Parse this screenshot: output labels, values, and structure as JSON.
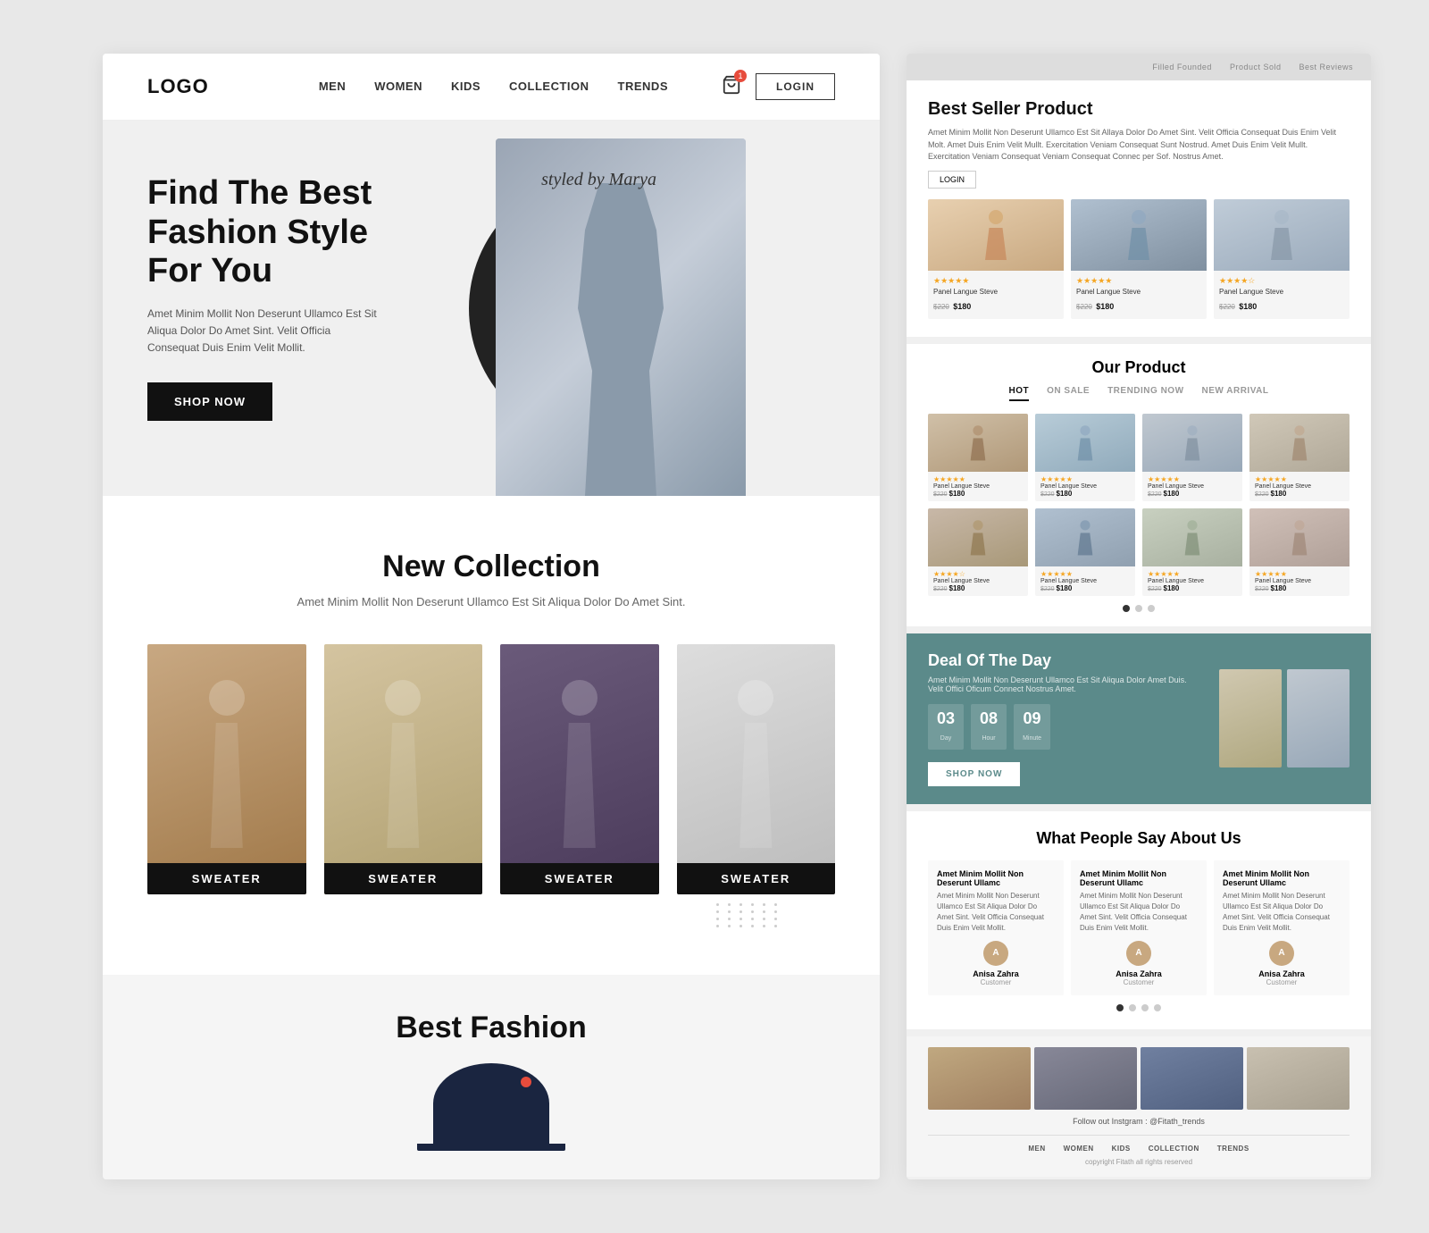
{
  "nav": {
    "logo": "LOGO",
    "links": [
      "MEN",
      "WOMEN",
      "KIDS",
      "COLLECTION",
      "TRENDS"
    ],
    "cart_badge": "1",
    "login_label": "LOGIN"
  },
  "hero": {
    "script_text": "styled by Marya",
    "title": "Find The Best Fashion Style For You",
    "subtitle": "Amet Minim Mollit Non Deserunt Ullamco Est Sit Aliqua Dolor Do Amet Sint. Velit Officia Consequat Duis Enim Velit Mollit.",
    "cta_label": "SHOP NOW"
  },
  "new_collection": {
    "title": "New Collection",
    "subtitle": "Amet Minim Mollit Non Deserunt Ullamco Est Sit Aliqua Dolor Do Amet Sint.",
    "items": [
      {
        "label": "SWEATER"
      },
      {
        "label": "SWEATER"
      },
      {
        "label": "SWEATER"
      },
      {
        "label": "SWEATER"
      }
    ]
  },
  "best_fashion": {
    "title": "Best Fashion"
  },
  "right": {
    "preview_tags": [
      "Filled Founded",
      "Product Sold",
      "Best Reviews"
    ],
    "best_seller": {
      "title": "Best Seller Product",
      "description": "Amet Minim Mollit Non Deserunt Ullamco Est Sit Allaya Dolor Do Amet Sint. Velit Officia Consequat Duis Enim Velit Molt. Amet Duis Enim Velit Mullt. Exercitation Veniam Consequat Sunt Nostrud. Amet Duis Enim Velit Mullt. Exercitation Veniam Consequat Veniam Consequat Connec per Sof. Nostrus Amet.",
      "login_label": "LOGIN",
      "products": [
        {
          "name": "Panel Langue Steve",
          "price_old": "$220",
          "price_new": "$180",
          "stars": "★★★★★"
        },
        {
          "name": "Panel Langue Steve",
          "price_old": "$220",
          "price_new": "$180",
          "stars": "★★★★★"
        },
        {
          "name": "Panel Langue Steve",
          "price_old": "$220",
          "price_new": "$180",
          "stars": "★★★★☆"
        }
      ]
    },
    "our_product": {
      "title": "Our Product",
      "tabs": [
        "HOT",
        "ON SALE",
        "TRENDING NOW",
        "NEW ARRIVAL"
      ],
      "active_tab": "HOT",
      "products_row1": [
        {
          "name": "Panel Langue Steve",
          "price_old": "$220",
          "price_new": "$180",
          "stars": "★★★★★"
        },
        {
          "name": "Panel Langue Steve",
          "price_old": "$220",
          "price_new": "$180",
          "stars": "★★★★★"
        },
        {
          "name": "Panel Langue Steve",
          "price_old": "$220",
          "price_new": "$180",
          "stars": "★★★★★"
        },
        {
          "name": "Panel Langue Steve",
          "price_old": "$220",
          "price_new": "$180",
          "stars": "★★★★★"
        }
      ],
      "products_row2": [
        {
          "name": "Panel Langue Steve",
          "price_old": "$220",
          "price_new": "$180",
          "stars": "★★★★☆"
        },
        {
          "name": "Panel Langue Steve",
          "price_old": "$220",
          "price_new": "$180",
          "stars": "★★★★★"
        },
        {
          "name": "Panel Langue Steve",
          "price_old": "$220",
          "price_new": "$180",
          "stars": "★★★★★"
        },
        {
          "name": "Panel Langue Steve",
          "price_old": "$220",
          "price_new": "$180",
          "stars": "★★★★★"
        }
      ]
    },
    "deal": {
      "title": "Deal Of The Day",
      "description": "Amet Minim Mollit Non Deserunt Ullamco Est Sit Aliqua Dolor Amet Duis. Velit Offici Oficum Connect Nostrus Amet.",
      "timer": {
        "day": "03",
        "hour": "08",
        "minute": "09"
      },
      "timer_labels": [
        "Day",
        "Hour",
        "Minute"
      ],
      "cta_label": "SHOP NOW"
    },
    "testimonials": {
      "title": "What People Say About Us",
      "cards": [
        {
          "name": "Amet Minim Mollit Non Deserunt Ullamc",
          "text": "Amet Minim Mollit Non Deserunt Ullamco Est Sit Aliqua Dolor Do Amet Sint. Velit Officia Consequat Duis Enim Velit Mollit.",
          "reviewer": "Anisa Zahra",
          "role": "Customer"
        },
        {
          "name": "Amet Minim Mollit Non Deserunt Ullamc",
          "text": "Amet Minim Mollit Non Deserunt Ullamco Est Sit Aliqua Dolor Do Amet Sint. Velit Officia Consequat Duis Enim Velit Mollit.",
          "reviewer": "Anisa Zahra",
          "role": "Customer"
        },
        {
          "name": "Amet Minim Mollit Non Deserunt Ullamc",
          "text": "Amet Minim Mollit Non Deserunt Ullamco Est Sit Aliqua Dolor Do Amet Sint. Velit Officia Consequat Duis Enim Velit Mollit.",
          "reviewer": "Anisa Zahra",
          "role": "Customer"
        }
      ],
      "dots": 4
    },
    "instagram": {
      "label": "Follow out Instgram : @Fitath_trends",
      "images": 4
    },
    "footer": {
      "links": [
        "MEN",
        "WOMEN",
        "KIDS",
        "COLLECTION",
        "TRENDS"
      ],
      "copyright": "copyright Fitath all rights reserved"
    }
  }
}
